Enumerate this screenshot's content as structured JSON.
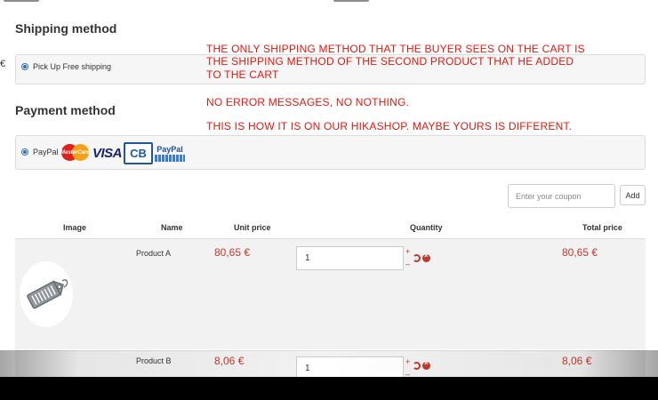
{
  "shipping": {
    "title": "Shipping method",
    "option_label": "Pick Up Free shipping"
  },
  "payment": {
    "title": "Payment method",
    "option_label": "PayPal",
    "logos": {
      "mastercard": "MasterCard",
      "visa": "VISA",
      "cb": "CB",
      "paypal": "PayPal"
    }
  },
  "annotation": {
    "lines": [
      "THE ONLY SHIPPING METHOD THAT THE BUYER SEES ON THE CART IS",
      "THE SHIPPING METHOD OF THE SECOND PRODUCT THAT HE ADDED",
      "TO THE CART",
      "NO ERROR MESSAGES, NO NOTHING.",
      "THIS IS HOW IT IS ON OUR HIKASHOP. MAYBE YOURS IS DIFFERENT."
    ],
    "color": "#e3180f"
  },
  "coupon": {
    "placeholder": "Enter your coupon",
    "add_label": "Add"
  },
  "cart": {
    "headers": {
      "image": "Image",
      "name": "Name",
      "unit_price": "Unit price",
      "quantity": "Quantity",
      "total_price": "Total price"
    },
    "rows": [
      {
        "name": "Product A",
        "unit_price": "80,65 €",
        "quantity": "1",
        "total_price": "80,65 €"
      },
      {
        "name": "Product B",
        "unit_price": "8,06 €",
        "quantity": "1",
        "total_price": "8,06 €"
      }
    ],
    "qty_controls": {
      "plus": "+",
      "minus": "–"
    },
    "price_color": "#c0392b"
  },
  "icons": [
    "radio-selected-icon",
    "mastercard-logo",
    "visa-logo",
    "cb-logo",
    "paypal-logo",
    "price-tag-icon",
    "refresh-icon",
    "remove-icon"
  ],
  "side_mark": "€"
}
